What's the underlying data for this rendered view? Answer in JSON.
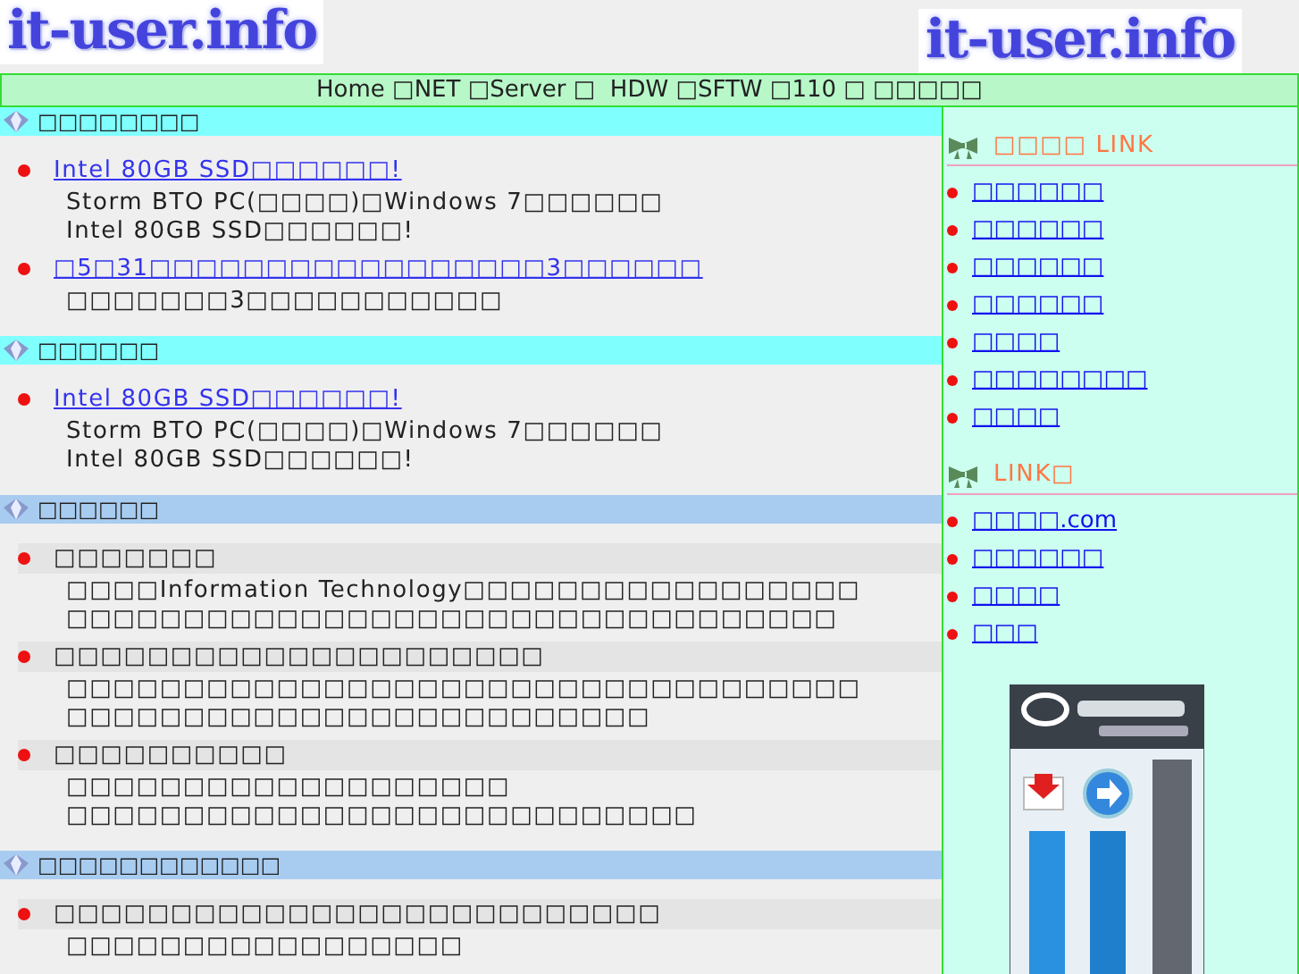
{
  "header": {
    "logo_left": "it-user.info",
    "logo_right": "it-user.info"
  },
  "nav": "Home □NET □Server □  HDW □SFTW □110 □ □□□□□",
  "sections": [
    {
      "kind": "news",
      "title": "□□□□□□□□",
      "items": [
        {
          "title": "Intel 80GB SSD□□□□□□!",
          "lines": [
            "Storm BTO PC(□□□□)□Windows 7□□□□□□",
            "Intel 80GB SSD□□□□□□!"
          ]
        },
        {
          "title": "□5□31□□□□□□□□□□□□□□□□□3□□□□□□",
          "lines": [
            "□□□□□□□3□□□□□□□□□□□"
          ]
        }
      ]
    },
    {
      "kind": "news",
      "title": "□□□□□□",
      "items": [
        {
          "title": "Intel 80GB SSD□□□□□□!",
          "lines": [
            "Storm BTO PC(□□□□)□Windows 7□□□□□□",
            "Intel 80GB SSD□□□□□□!"
          ]
        }
      ]
    },
    {
      "kind": "topic",
      "title": "□□□□□□",
      "items": [
        {
          "title": "□□□□□□□",
          "lines": [
            "□□□□Information Technology□□□□□□□□□□□□□□□□□",
            "□□□□□□□□□□□□□□□□□□□□□□□□□□□□□□□□□"
          ]
        },
        {
          "title": "□□□□□□□□□□□□□□□□□□□□□",
          "lines": [
            "□□□□□□□□□□□□□□□□□□□□□□□□□□□□□□□□□□",
            "□□□□□□□□□□□□□□□□□□□□□□□□□"
          ]
        },
        {
          "title": "□□□□□□□□□□",
          "lines": [
            "□□□□□□□□□□□□□□□□□□□",
            "□□□□□□□□□□□□□□□□□□□□□□□□□□□"
          ]
        }
      ]
    },
    {
      "kind": "topic",
      "title": "□□□□□□□□□□□□",
      "items": [
        {
          "title": "□□□□□□□□□□□□□□□□□□□□□□□□□□",
          "lines": [
            "□□□□□□□□□□□□□□□□□"
          ]
        }
      ]
    }
  ],
  "sidebar": [
    {
      "title": "□□□□ LINK",
      "links": [
        "□□□□□□",
        "□□□□□□",
        "□□□□□□",
        "□□□□□□",
        "□□□□",
        "□□□□□□□□",
        "□□□□"
      ]
    },
    {
      "title": "LINK□",
      "links": [
        "□□□□.com",
        "□□□□□□",
        "□□□□",
        "□□□"
      ]
    }
  ]
}
